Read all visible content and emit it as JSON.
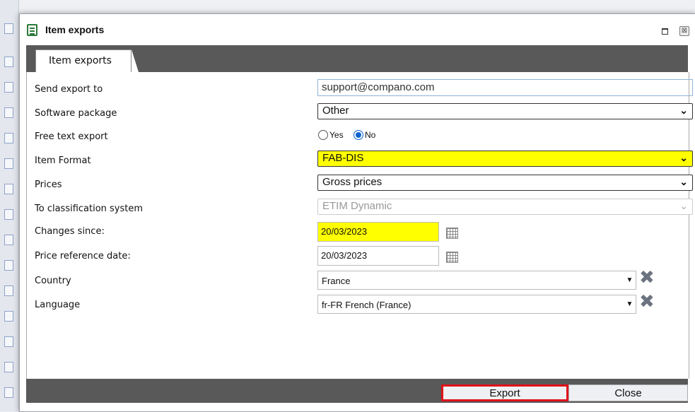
{
  "window": {
    "title": "Item exports",
    "title_icon": "form-icon",
    "maximize_icon": "maximize-icon",
    "close_icon": "close-icon",
    "close_glyph": "⊠"
  },
  "tabs": [
    {
      "label": "Item exports",
      "active": true
    }
  ],
  "form": {
    "send_export_to": {
      "label": "Send export to",
      "value": "support@compano.com"
    },
    "software_package": {
      "label": "Software package",
      "value": "Other"
    },
    "free_text_export": {
      "label": "Free text export",
      "options": [
        "Yes",
        "No"
      ],
      "selected": "No"
    },
    "item_format": {
      "label": "Item Format",
      "value": "FAB-DIS",
      "highlight": "#ffff00"
    },
    "prices": {
      "label": "Prices",
      "value": "Gross prices"
    },
    "to_classification_system": {
      "label": "To classification system",
      "value": "ETIM Dynamic",
      "disabled": true
    },
    "changes_since": {
      "label": "Changes since:",
      "value": "20/03/2023",
      "highlight": "#ffff00"
    },
    "price_reference_date": {
      "label": "Price reference date:",
      "value": "20/03/2023"
    },
    "country": {
      "label": "Country",
      "value": "France"
    },
    "language": {
      "label": "Language",
      "value": "fr-FR French (France)"
    }
  },
  "footer": {
    "export_label": "Export",
    "close_label": "Close",
    "export_outline_color": "#e0121a"
  },
  "colors": {
    "bar_background": "#595959",
    "highlight": "#ffff00",
    "radio_accent": "#0b63d1"
  }
}
